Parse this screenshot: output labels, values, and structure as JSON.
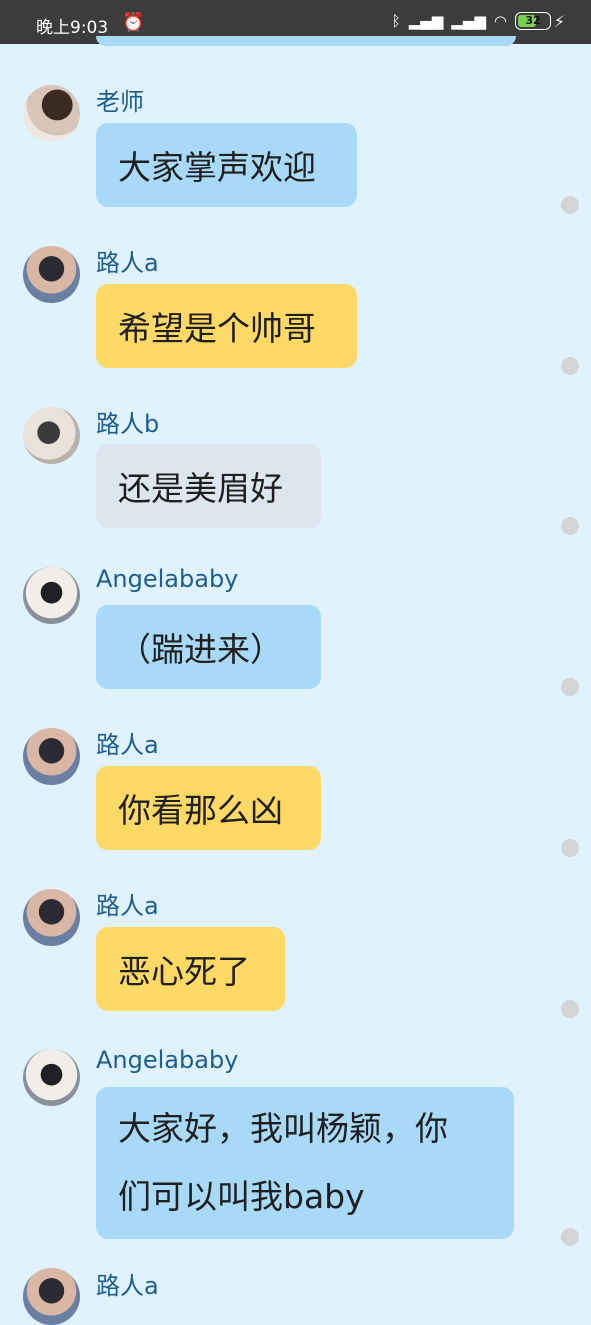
{
  "status_bar": {
    "time": "晚上9:03",
    "alarm_icon": "alarm-clock-icon",
    "bluetooth_icon": "bluetooth-icon",
    "signal_icon": "signal-icon",
    "hd_signal_icon": "hd-signal-icon",
    "wifi_icon": "wifi-icon",
    "battery": "32",
    "charging_icon": "lightning-bolt-icon"
  },
  "messages": [
    {
      "sender": "老师",
      "text": "大家掌声欢迎",
      "color": "#a8daf8"
    },
    {
      "sender": "路人a",
      "text": "希望是个帅哥",
      "color": "#ffd966"
    },
    {
      "sender": "路人b",
      "text": "还是美眉好",
      "color": "#dde6ee"
    },
    {
      "sender": "Angelababy",
      "text": "（踹进来）",
      "color": "#a8daf8"
    },
    {
      "sender": "路人a",
      "text": "你看那么凶",
      "color": "#ffd966"
    },
    {
      "sender": "路人a",
      "text": "恶心死了",
      "color": "#ffd966"
    },
    {
      "sender": "Angelababy",
      "text_line1": "大家好，我叫杨颖，你",
      "text_line2": "们可以叫我baby",
      "color": "#a8daf8"
    }
  ],
  "bottom_peek": {
    "sender": "路人a"
  },
  "colors": {
    "background": "#dff2fd",
    "status_bar": "#3c3c3c",
    "name_text": "#1c5e8f",
    "blue_bubble": "#a8daf8",
    "yellow_bubble": "#ffd966",
    "gray_bubble": "#dde6ee"
  }
}
